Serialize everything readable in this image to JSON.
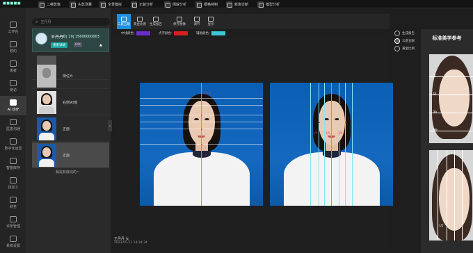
{
  "topbar": {
    "logo": "■■■■■",
    "items": [
      "二维影像",
      "头影测量",
      "全景模拟",
      "正貌分析",
      "侧貌分析",
      "细格特制",
      "新像诊断",
      "模型分析"
    ]
  },
  "leftnav": [
    {
      "label": "工作台",
      "icon": "desk-icon"
    },
    {
      "label": "预约",
      "icon": "calendar-icon"
    },
    {
      "label": "患者",
      "icon": "patient-icon"
    },
    {
      "label": "随访",
      "icon": "phone-icon"
    },
    {
      "label": "AI 诊疗",
      "icon": "heart-icon"
    },
    {
      "label": "医患沟通",
      "icon": "chat-icon"
    },
    {
      "label": "数字化运营",
      "icon": "monitor-icon"
    },
    {
      "label": "智能库存",
      "icon": "box-icon"
    },
    {
      "label": "技加工",
      "icon": "tool-icon"
    },
    {
      "label": "财务",
      "icon": "wallet-icon"
    },
    {
      "label": "诊所管理",
      "icon": "settings-icon"
    },
    {
      "label": "系统设置",
      "icon": "gear-icon"
    }
  ],
  "search": {
    "placeholder": "王丹丹"
  },
  "patient": {
    "name": "王丹丹",
    "info": "女| 19| 15600000003",
    "tag": "患者详情",
    "badge": "Old",
    "arrow": "▲"
  },
  "thumbnails": [
    {
      "label": ""
    },
    {
      "label": "侧位片"
    },
    {
      "label": "右侧90度"
    },
    {
      "label": "正面"
    },
    {
      "label": "正面"
    }
  ],
  "end_text": "我是有底线的~",
  "tools": [
    {
      "label": "三庭五眼"
    },
    {
      "label": "黄金比例"
    },
    {
      "label": "生成报告"
    },
    {
      "label": "保存图像"
    },
    {
      "label": "调节"
    },
    {
      "label": "显示"
    }
  ],
  "colors": {
    "label1": "中线颜色:",
    "color1": "#6a2fc7",
    "label2": "点字颜色:",
    "color2": "#d81f1f",
    "label3": "辅助颜色:",
    "color3": "#3cc8d8"
  },
  "caption": {
    "name": "王丹丹  女",
    "date": "2023-05-11 14:34:34"
  },
  "right_menu": [
    {
      "label": "生成报告"
    },
    {
      "label": "三庭五眼"
    },
    {
      "label": "黄金比例"
    }
  ],
  "ref": {
    "title": "标准美学参考",
    "labels": [
      "Tr",
      "Gl",
      "Sn",
      "Me"
    ],
    "bottom_label": "1/5"
  },
  "measure": {
    "left": [
      "1:1:1"
    ],
    "right": [
      "1/5",
      "1/5",
      "1/5"
    ]
  }
}
